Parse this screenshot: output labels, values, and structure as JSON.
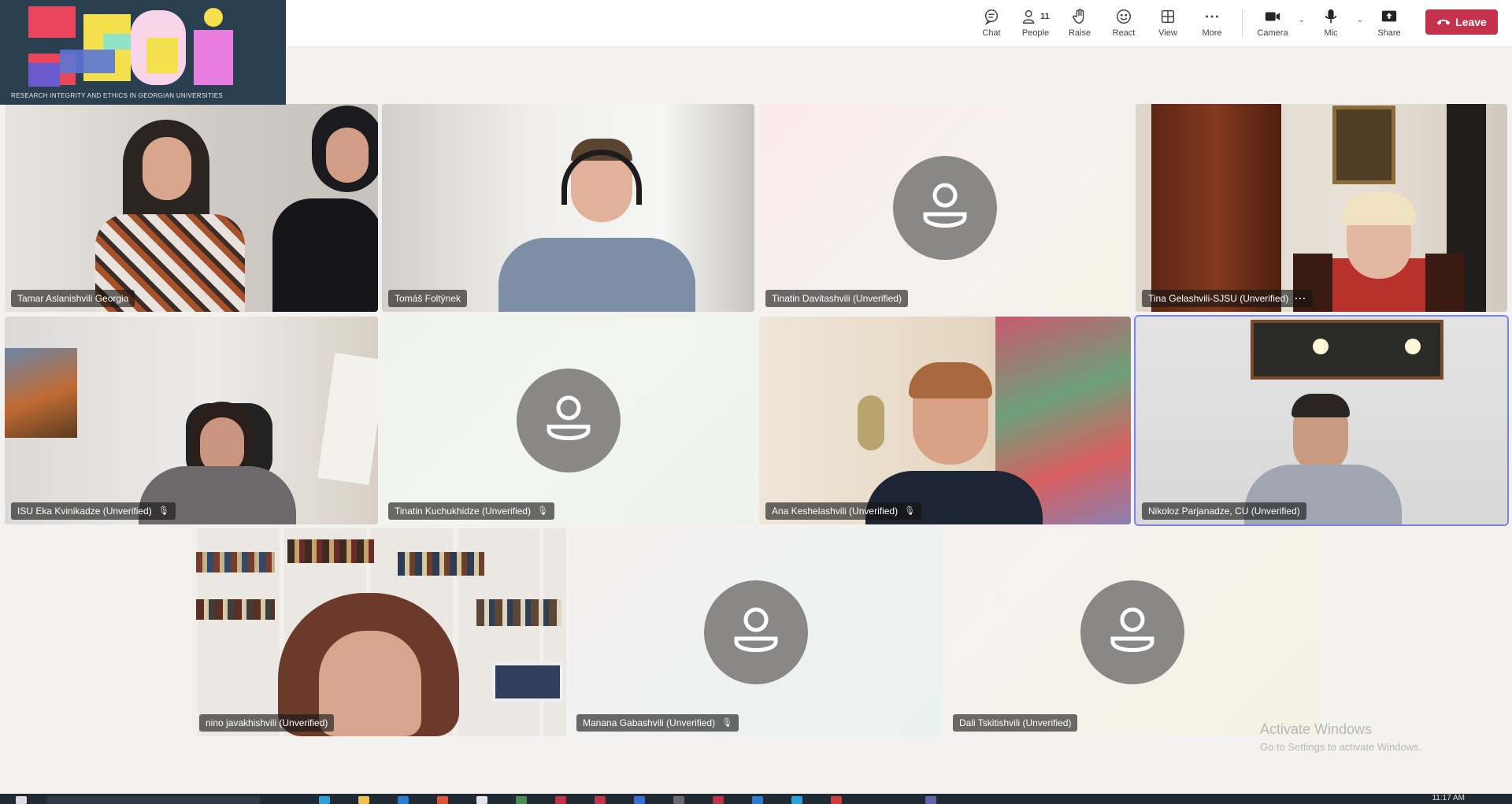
{
  "logo": {
    "name": "EFGI",
    "caption": "RESEARCH INTEGRITY AND ETHICS IN GEORGIAN UNIVERSITIES"
  },
  "toolbar": {
    "chat": "Chat",
    "people": "People",
    "people_count": "11",
    "raise": "Raise",
    "react": "React",
    "view": "View",
    "more": "More",
    "camera": "Camera",
    "mic": "Mic",
    "share": "Share",
    "leave": "Leave"
  },
  "participants": [
    {
      "name": "Tamar Aslanishvili Georgia",
      "video": true
    },
    {
      "name": "Tomáš Foltýnek",
      "video": true
    },
    {
      "name": "Tinatin Davitashvili (Unverified)",
      "video": false
    },
    {
      "name": "Tina Gelashvili-SJSU (Unverified)",
      "video": true,
      "more": "···"
    },
    {
      "name": "ISU Eka Kvinikadze (Unverified)",
      "video": true,
      "muted": true
    },
    {
      "name": "Tinatin Kuchukhidze (Unverified)",
      "video": false,
      "muted": true
    },
    {
      "name": "Ana Keshelashvili (Unverified)",
      "video": true,
      "muted": true
    },
    {
      "name": "Nikoloz Parjanadze, CU (Unverified)",
      "video": true,
      "active_speaker": true
    },
    {
      "name": "nino javakhishvili (Unverified)",
      "video": true
    },
    {
      "name": "Manana Gabashvili (Unverified)",
      "video": false,
      "muted": true
    },
    {
      "name": "Dali Tskitishvili (Unverified)",
      "video": false
    }
  ],
  "watermark": {
    "line1": "Activate Windows",
    "line2": "Go to Settings to activate Windows."
  },
  "taskbar": {
    "time": "11:17 AM"
  },
  "colors": {
    "leave": "#c4314b",
    "active_border": "#7b83eb",
    "avatar": "#8a8886"
  }
}
